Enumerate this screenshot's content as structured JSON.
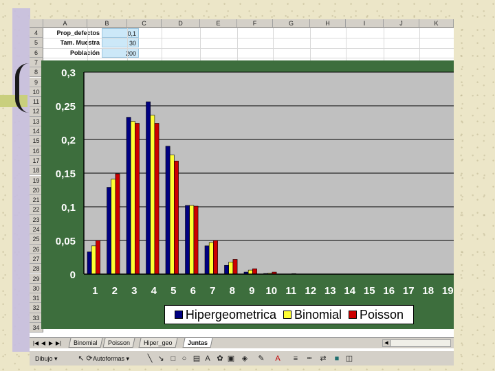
{
  "spreadsheet": {
    "columns": [
      "A",
      "B",
      "C",
      "D",
      "E",
      "F",
      "G",
      "H",
      "I",
      "J",
      "K"
    ],
    "rows": [
      "4",
      "5",
      "6",
      "7",
      "8",
      "9",
      "10",
      "11",
      "12",
      "13",
      "14",
      "15",
      "16",
      "17",
      "18",
      "19",
      "20",
      "21",
      "22",
      "23",
      "24",
      "25",
      "26",
      "27",
      "28",
      "29",
      "30",
      "31",
      "32",
      "33",
      "34"
    ],
    "params": [
      {
        "label": "Prop_defectos",
        "value": "0,1"
      },
      {
        "label": "Tam. Muestra",
        "value": "30"
      },
      {
        "label": "Población",
        "value": "200"
      }
    ]
  },
  "chart_data": {
    "type": "bar",
    "categories": [
      "1",
      "2",
      "3",
      "4",
      "5",
      "6",
      "7",
      "8",
      "9",
      "10",
      "11",
      "12",
      "13",
      "14",
      "15",
      "16",
      "17",
      "18",
      "19"
    ],
    "series": [
      {
        "name": "Hipergeometrica",
        "color": "#000080",
        "values": [
          0.033,
          0.129,
          0.233,
          0.256,
          0.19,
          0.102,
          0.042,
          0.013,
          0.003,
          0.001,
          0.0002,
          0,
          0,
          0,
          0,
          0,
          0,
          0,
          0
        ]
      },
      {
        "name": "Binomial",
        "color": "#ffff33",
        "values": [
          0.042,
          0.141,
          0.227,
          0.236,
          0.177,
          0.102,
          0.047,
          0.018,
          0.006,
          0.0015,
          0.0003,
          0,
          0,
          0,
          0,
          0,
          0,
          0,
          0
        ]
      },
      {
        "name": "Poisson",
        "color": "#cc0000",
        "values": [
          0.05,
          0.149,
          0.224,
          0.224,
          0.168,
          0.101,
          0.05,
          0.022,
          0.008,
          0.003,
          0.0008,
          0.0002,
          0,
          0,
          0,
          0,
          0,
          0,
          0
        ]
      }
    ],
    "yticks": [
      "0",
      "0,05",
      "0,1",
      "0,15",
      "0,2",
      "0,25",
      "0,3"
    ],
    "ylim": [
      0,
      0.3
    ],
    "grid": true,
    "legend_position": "bottom",
    "plot_background": "#c0c0c0",
    "chart_background": "#3d6e3d"
  },
  "tabs": {
    "nav": [
      "|◀",
      "◀",
      "▶",
      "▶|"
    ],
    "sheets": [
      {
        "label": "Binomial",
        "active": false
      },
      {
        "label": "Poisson",
        "active": false
      },
      {
        "label": "Hiper_geo",
        "active": false
      },
      {
        "label": "Juntas",
        "active": true
      }
    ]
  },
  "toolbar": {
    "draw_label": "Dibujo",
    "autoshapes_label": "Autoformas",
    "icons": [
      "pointer-icon",
      "rotate-icon",
      "line-icon",
      "arrow-icon",
      "rectangle-icon",
      "oval-icon",
      "textbox-icon",
      "wordart-icon",
      "clipart-icon",
      "image-icon",
      "fill-color-icon",
      "line-color-icon",
      "font-color-icon",
      "line-style-icon",
      "dash-style-icon",
      "arrow-style-icon",
      "shadow-icon",
      "3d-icon"
    ]
  }
}
